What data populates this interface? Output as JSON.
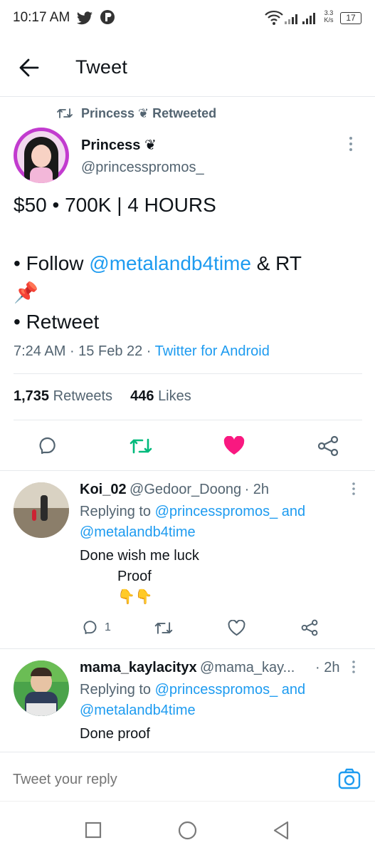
{
  "status_bar": {
    "time": "10:17 AM",
    "net_speed_top": "3.3",
    "net_speed_bottom": "K/s",
    "battery": "17"
  },
  "header": {
    "title": "Tweet"
  },
  "tweet": {
    "retweeted_by": "Princess ❦ Retweeted",
    "author_name": "Princess ❦",
    "author_handle": "@princesspromos_",
    "line1": "$50 • 700K | 4 HOURS",
    "follow_prefix": "• Follow ",
    "follow_mention": "@metalandb4time",
    "follow_suffix": " & RT",
    "pin_emoji": "📌",
    "line_retweet": "• Retweet",
    "time": "7:24 AM",
    "date": "15 Feb 22",
    "source": "Twitter for Android",
    "retweets_count": "1,735",
    "retweets_label": "Retweets",
    "likes_count": "446",
    "likes_label": "Likes"
  },
  "replies": [
    {
      "name": "Koi_02",
      "handle": "@Gedoor_Doong",
      "time": "· 2h",
      "replying_to": "Replying to",
      "mention1": "@princesspromos_",
      "and": "and",
      "mention2": "@metalandb4time",
      "text1": "Done wish me luck",
      "text2": "Proof",
      "emoji": "👇👇",
      "reply_count": "1"
    },
    {
      "name": "mama_kaylacityx",
      "handle": "@mama_kay...",
      "time": "· 2h",
      "replying_to": "Replying to",
      "mention1": "@princesspromos_",
      "and": "and",
      "mention2": "@metalandb4time",
      "text1": "Done proof"
    }
  ],
  "composer": {
    "placeholder": "Tweet your reply"
  },
  "colors": {
    "accent": "#1d9bf0",
    "retweet_green": "#00ba7c",
    "like_pink": "#f91880"
  }
}
